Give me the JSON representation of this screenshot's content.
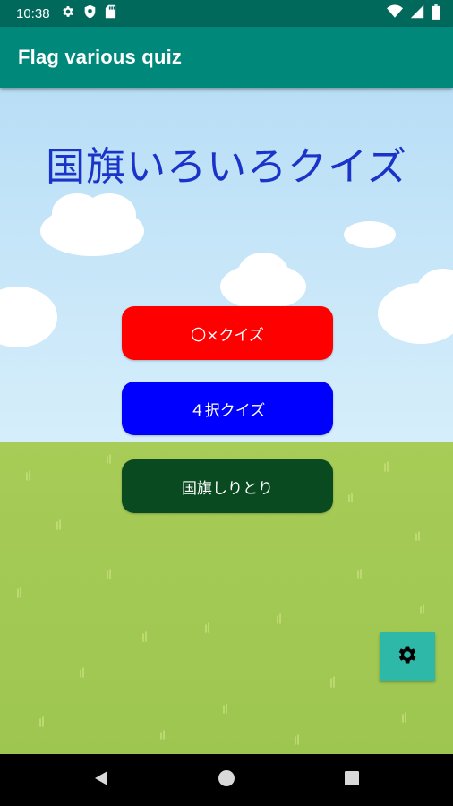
{
  "status_bar": {
    "time": "10:38",
    "left_icons": [
      "gear-icon",
      "shield-icon",
      "sd-card-icon"
    ],
    "right_icons": [
      "wifi-icon",
      "signal-icon",
      "battery-icon"
    ]
  },
  "app_bar": {
    "title": "Flag various quiz"
  },
  "main": {
    "title": "国旗いろいろクイズ",
    "buttons": [
      {
        "label": "〇×クイズ",
        "color": "#ff0000"
      },
      {
        "label": "４択クイズ",
        "color": "#0000ff"
      },
      {
        "label": "国旗しりとり",
        "color": "#0a4a20"
      }
    ],
    "settings_icon": "gear-icon"
  },
  "colors": {
    "status_bar": "#00695c",
    "app_bar": "#00897b",
    "sky": "#bfe3f7",
    "grass": "#a4c954",
    "title_text": "#1a33c9",
    "settings_button": "#2db8a8"
  },
  "nav_bar": {
    "items": [
      "back-icon",
      "home-icon",
      "recents-icon"
    ]
  }
}
